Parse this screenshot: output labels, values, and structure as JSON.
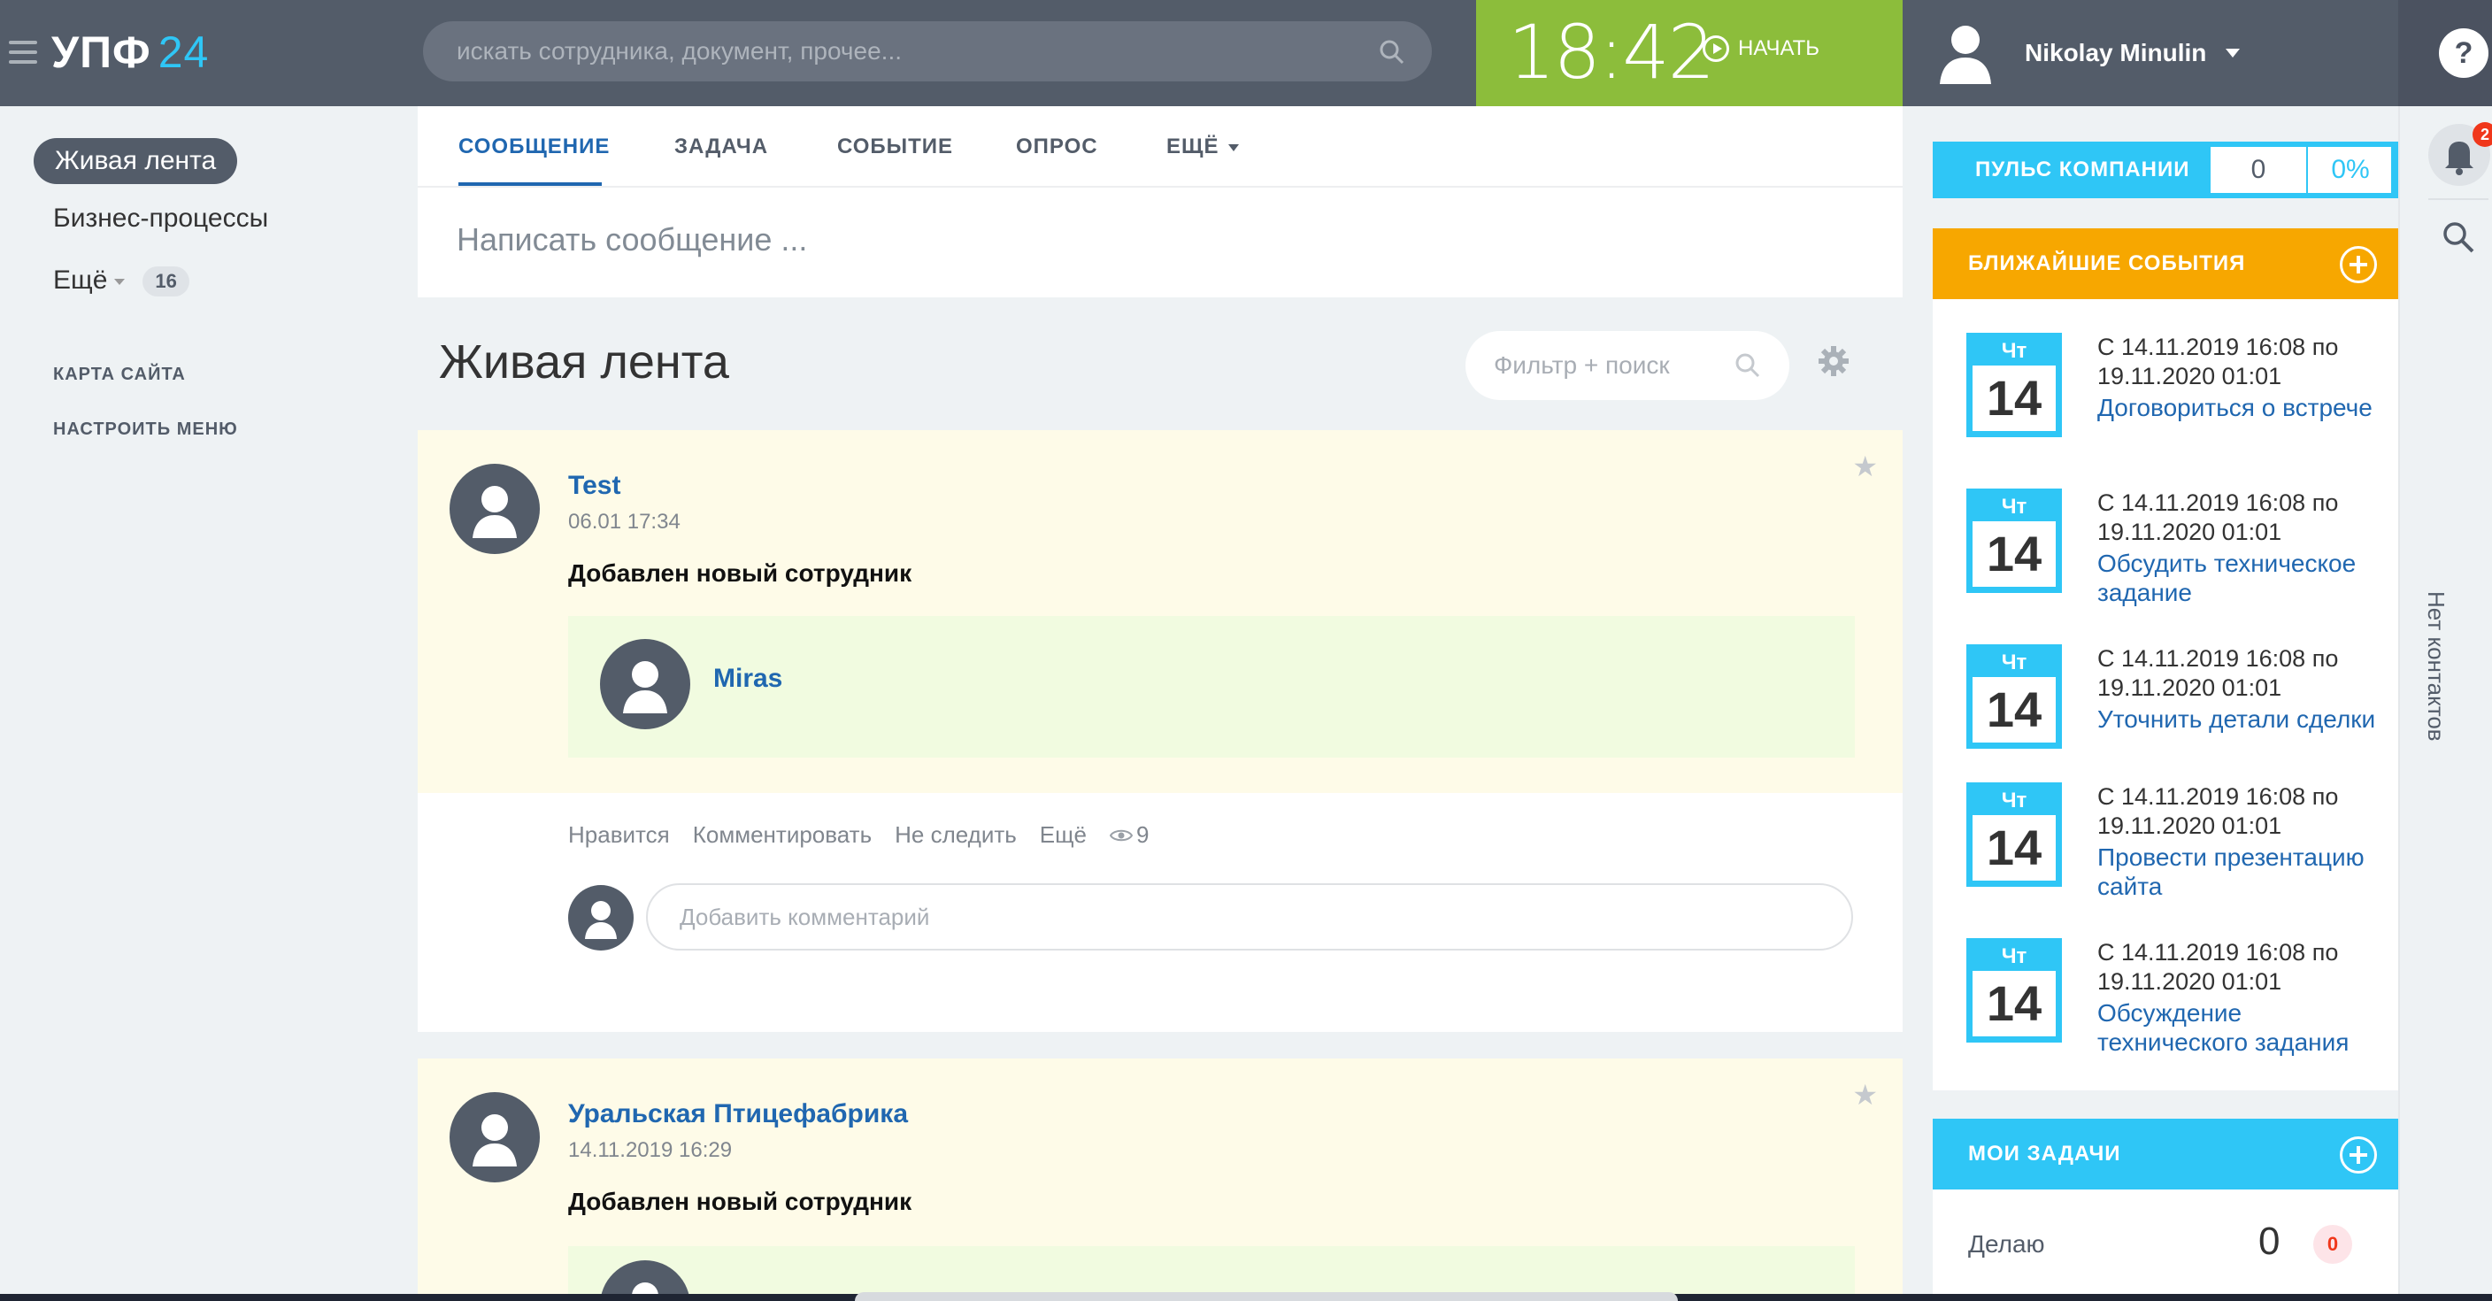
{
  "header": {
    "logo_main": "УПФ",
    "logo_num": "24",
    "search_placeholder": "искать сотрудника, документ, прочее...",
    "time": "18:42",
    "start_label": "НАЧАТЬ",
    "user_name": "Nikolay Minulin",
    "help_label": "?"
  },
  "left_menu": {
    "active": "Живая лента",
    "items": [
      {
        "label": "Бизнес-процессы"
      },
      {
        "label": "Ещё",
        "badge": "16"
      }
    ],
    "links": [
      "КАРТА САЙТА",
      "НАСТРОИТЬ МЕНЮ"
    ]
  },
  "composer": {
    "tabs": [
      "СООБЩЕНИЕ",
      "ЗАДАЧА",
      "СОБЫТИЕ",
      "ОПРОС",
      "ЕЩЁ"
    ],
    "placeholder": "Написать сообщение ..."
  },
  "feed": {
    "title": "Живая лента",
    "filter_placeholder": "Фильтр + поиск",
    "posts": [
      {
        "author": "Test",
        "date": "06.01 17:34",
        "text": "Добавлен новый сотрудник",
        "employee": "Miras",
        "actions": [
          "Нравится",
          "Комментировать",
          "Не следить",
          "Ещё"
        ],
        "views": "9",
        "comment_placeholder": "Добавить комментарий"
      },
      {
        "author": "Уральская Птицефабрика",
        "date": "14.11.2019 16:29",
        "text": "Добавлен новый сотрудник"
      }
    ]
  },
  "right": {
    "pulse_label": "ПУЛЬС КОМПАНИИ",
    "pulse_value": "0",
    "pulse_percent": "0%",
    "events_title": "БЛИЖАЙШИЕ СОБЫТИЯ",
    "events": [
      {
        "dow": "Чт",
        "day": "14",
        "time": "С 14.11.2019 16:08 по 19.11.2020 01:01",
        "title": "Договориться о встрече"
      },
      {
        "dow": "Чт",
        "day": "14",
        "time": "С 14.11.2019 16:08 по 19.11.2020 01:01",
        "title": "Обсудить техническое задание"
      },
      {
        "dow": "Чт",
        "day": "14",
        "time": "С 14.11.2019 16:08 по 19.11.2020 01:01",
        "title": "Уточнить детали сделки"
      },
      {
        "dow": "Чт",
        "day": "14",
        "time": "С 14.11.2019 16:08 по 19.11.2020 01:01",
        "title": "Провести презентацию сайта"
      },
      {
        "dow": "Чт",
        "day": "14",
        "time": "С 14.11.2019 16:08 по 19.11.2020 01:01",
        "title": "Обсуждение технического задания"
      }
    ],
    "tasks_title": "МОИ ЗАДАЧИ",
    "task_label": "Делаю",
    "task_count": "0",
    "task_overdue": "0"
  },
  "strip": {
    "notif_count": "2",
    "contacts_label": "Нет контактов"
  }
}
